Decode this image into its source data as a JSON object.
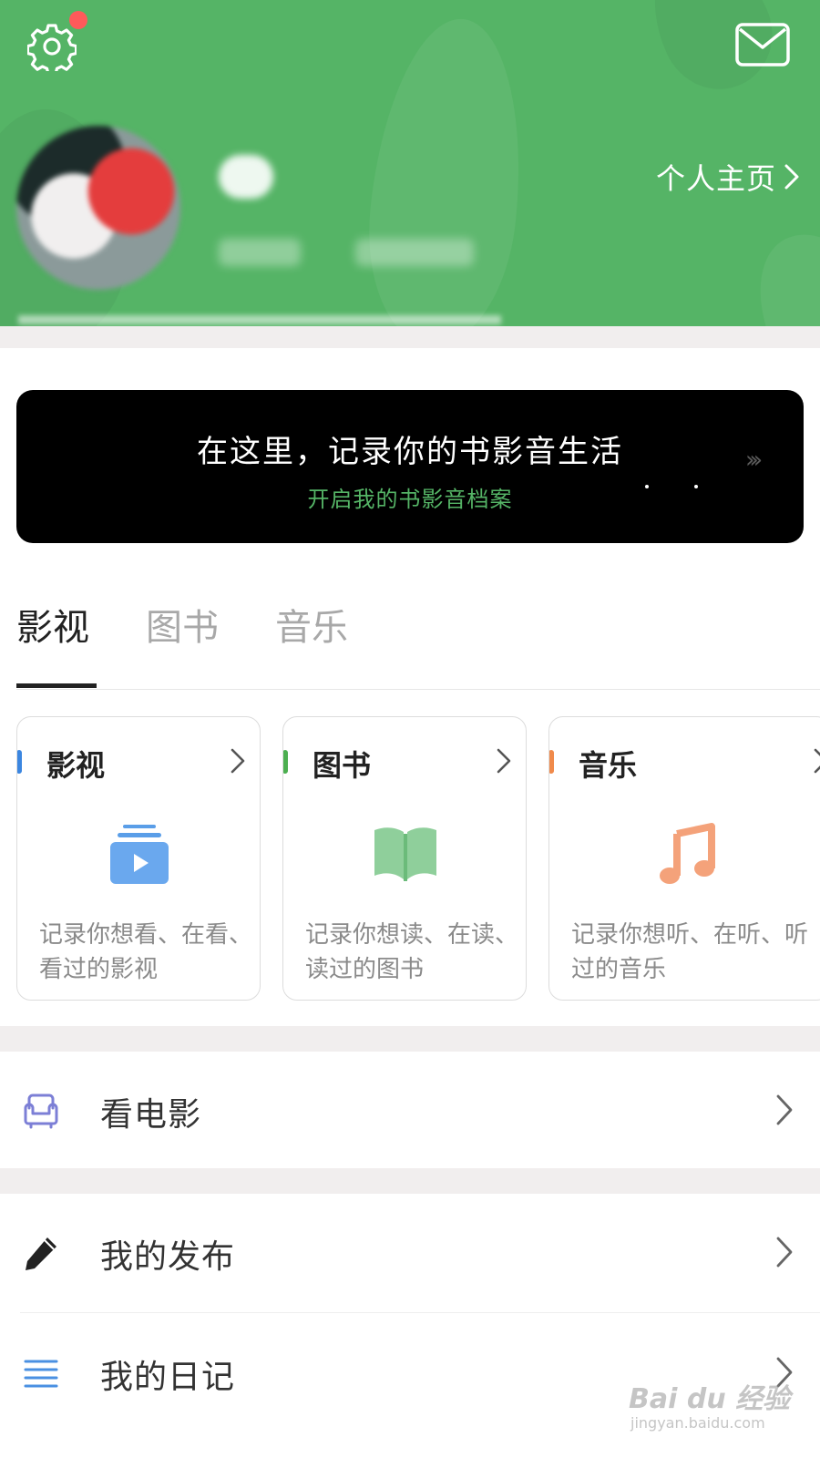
{
  "header": {
    "profile_link_label": "个人主页",
    "notification_dot_color": "#ff5a5a",
    "background_color": "#55b466",
    "icons": {
      "settings": "gear-icon",
      "mail": "envelope-icon",
      "profile_chevron": "chevron-right-icon"
    }
  },
  "banner": {
    "title": "在这里，记录你的书影音生活",
    "subtitle": "开启我的书影音档案",
    "subtitle_color": "#55b466",
    "arrows": "›››"
  },
  "tabs": [
    {
      "label": "影视",
      "active": true
    },
    {
      "label": "图书",
      "active": false
    },
    {
      "label": "音乐",
      "active": false
    }
  ],
  "cards": [
    {
      "title": "影视",
      "accent_color": "#3b86e0",
      "icon": "video-stack-icon",
      "description": "记录你想看、在看、看过的影视"
    },
    {
      "title": "图书",
      "accent_color": "#4caf50",
      "icon": "open-book-icon",
      "description": "记录你想读、在读、读过的图书"
    },
    {
      "title": "音乐",
      "accent_color": "#f08a4b",
      "icon": "music-note-icon",
      "description": "记录你想听、在听、听过的音乐"
    }
  ],
  "menu": [
    {
      "label": "看电影",
      "icon": "armchair-icon"
    },
    {
      "label": "我的发布",
      "icon": "pencil-icon"
    },
    {
      "label": "我的日记",
      "icon": "text-lines-icon"
    }
  ],
  "watermark": {
    "main": "Bai du 经验",
    "sub": "jingyan.baidu.com"
  }
}
